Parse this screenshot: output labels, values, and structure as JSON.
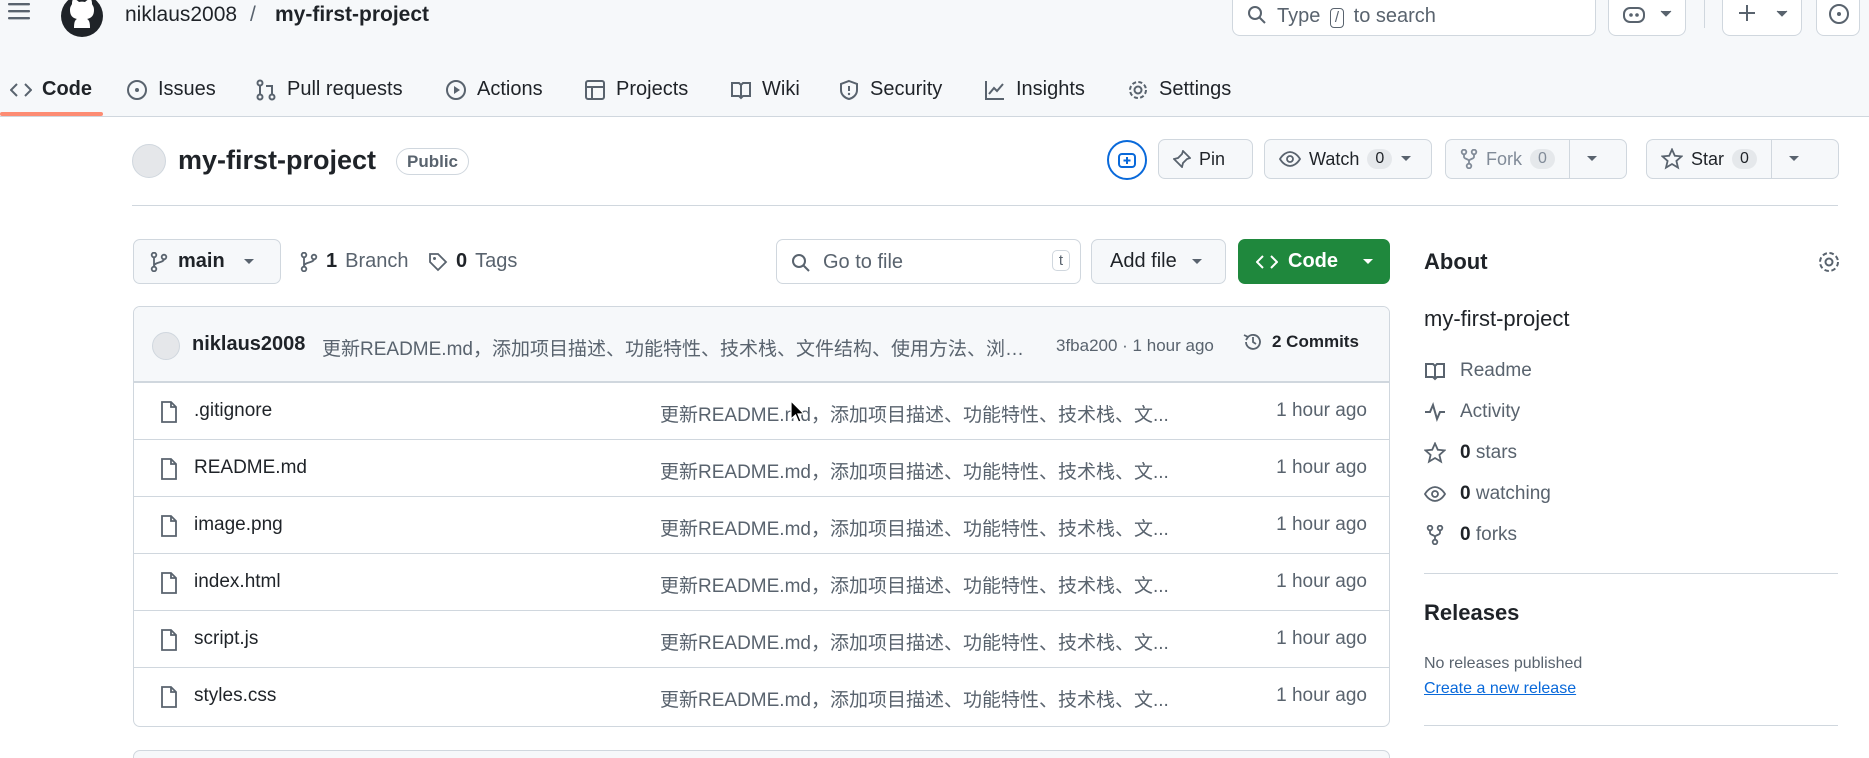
{
  "header": {
    "owner": "niklaus2008",
    "separator": "/",
    "repo": "my-first-project",
    "search_prefix": "Type",
    "search_key": "/",
    "search_suffix": "to search"
  },
  "tabs": [
    {
      "label": "Code",
      "icon": "code-icon"
    },
    {
      "label": "Issues",
      "icon": "issue-icon"
    },
    {
      "label": "Pull requests",
      "icon": "pull-request-icon"
    },
    {
      "label": "Actions",
      "icon": "play-icon"
    },
    {
      "label": "Projects",
      "icon": "table-icon"
    },
    {
      "label": "Wiki",
      "icon": "book-icon"
    },
    {
      "label": "Security",
      "icon": "shield-icon"
    },
    {
      "label": "Insights",
      "icon": "graph-icon"
    },
    {
      "label": "Settings",
      "icon": "gear-icon"
    }
  ],
  "repo": {
    "title": "my-first-project",
    "visibility": "Public",
    "pin_label": "Pin",
    "watch_label": "Watch",
    "watch_count": "0",
    "fork_label": "Fork",
    "fork_count": "0",
    "star_label": "Star",
    "star_count": "0"
  },
  "branchbar": {
    "branch": "main",
    "branches_count": "1",
    "branches_label": "Branch",
    "tags_count": "0",
    "tags_label": "Tags",
    "goto_placeholder": "Go to file",
    "goto_key": "t",
    "add_file": "Add file",
    "code_button": "Code"
  },
  "latest_commit": {
    "author": "niklaus2008",
    "message": "更新README.md，添加项目描述、功能特性、技术栈、文件结构、使用方法、浏…",
    "sha_time": "3fba200 · 1 hour ago",
    "commits_label": "2 Commits"
  },
  "files": [
    {
      "name": ".gitignore",
      "message": "更新README.md，添加项目描述、功能特性、技术栈、文...",
      "time": "1 hour ago"
    },
    {
      "name": "README.md",
      "message": "更新README.md，添加项目描述、功能特性、技术栈、文...",
      "time": "1 hour ago"
    },
    {
      "name": "image.png",
      "message": "更新README.md，添加项目描述、功能特性、技术栈、文...",
      "time": "1 hour ago"
    },
    {
      "name": "index.html",
      "message": "更新README.md，添加项目描述、功能特性、技术栈、文...",
      "time": "1 hour ago"
    },
    {
      "name": "script.js",
      "message": "更新README.md，添加项目描述、功能特性、技术栈、文...",
      "time": "1 hour ago"
    },
    {
      "name": "styles.css",
      "message": "更新README.md，添加项目描述、功能特性、技术栈、文...",
      "time": "1 hour ago"
    }
  ],
  "about": {
    "title": "About",
    "name": "my-first-project",
    "readme": "Readme",
    "activity": "Activity",
    "stars_count": "0",
    "stars_label": "stars",
    "watching_count": "0",
    "watching_label": "watching",
    "forks_count": "0",
    "forks_label": "forks"
  },
  "releases": {
    "title": "Releases",
    "none": "No releases published",
    "create_link": "Create a new release"
  },
  "colors": {
    "accent": "#0969da",
    "primary_button": "#1f883d",
    "active_tab_underline": "#fd8c73"
  }
}
